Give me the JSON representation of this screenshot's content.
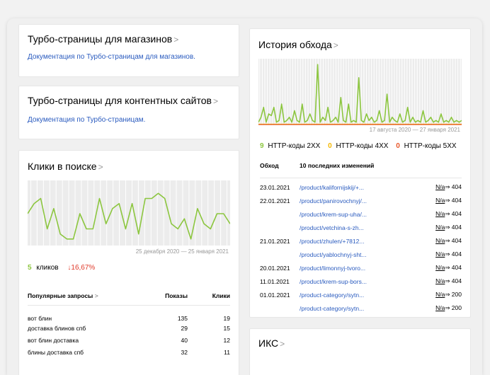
{
  "shops": {
    "title": "Турбо-страницы для магазинов",
    "link": "Документация по Турбо-страницам для магазинов."
  },
  "content_sites": {
    "title": "Турбо-страницы для контентных сайтов",
    "link": "Документация по Турбо-страницам."
  },
  "clicks": {
    "title": "Клики в поиске",
    "date_range": "25 декабря 2020 — 25 января 2021",
    "count": "5",
    "count_label": "кликов",
    "change": "↓16,67%",
    "table": {
      "headers": [
        "Популярные запросы",
        "Показы",
        "Клики"
      ],
      "rows": [
        [
          "вот блин",
          "135",
          "19"
        ],
        [
          "доставка блинов спб",
          "29",
          "15"
        ],
        [
          "вот блин доставка",
          "40",
          "12"
        ],
        [
          "блины доставка спб",
          "32",
          "11"
        ]
      ]
    }
  },
  "history": {
    "title": "История обхода",
    "date_range": "17 августа 2020 — 27 января 2021",
    "legend": [
      {
        "count": "9",
        "label": "HTTP-коды 2XX",
        "color": "#8cc63f"
      },
      {
        "count": "0",
        "label": "HTTP-коды 4XX",
        "color": "#f5b800"
      },
      {
        "count": "0",
        "label": "HTTP-коды 5XX",
        "color": "#e8572a"
      }
    ],
    "table": {
      "headers": [
        "Обход",
        "10 последних изменений"
      ],
      "rows": [
        [
          "23.01.2021",
          "/product/kalifornijskij/+...",
          "N/a",
          "⇒ 404"
        ],
        [
          "22.01.2021",
          "/product/panirovochnyj/...",
          "N/a",
          "⇒ 404"
        ],
        [
          "",
          "/product/krem-sup-uha/...",
          "N/a",
          "⇒ 404"
        ],
        [
          "",
          "/product/vetchina-s-zh...",
          "N/a",
          "⇒ 404"
        ],
        [
          "21.01.2021",
          "/product/zhulen/+7812...",
          "N/a",
          "⇒ 404"
        ],
        [
          "",
          "/product/yablochnyj-sht...",
          "N/a",
          "⇒ 404"
        ],
        [
          "20.01.2021",
          "/product/limonnyj-tvoro...",
          "N/a",
          "⇒ 404"
        ],
        [
          "11.01.2021",
          "/product/krem-sup-bors...",
          "N/a",
          "⇒ 404"
        ],
        [
          "01.01.2021",
          "/product-category/sytn...",
          "N/a",
          "⇒ 200"
        ],
        [
          "",
          "/product-category/sytn...",
          "N/a",
          "⇒ 200"
        ]
      ]
    }
  },
  "iks": {
    "title": "ИКС"
  },
  "chart_data": [
    {
      "type": "line",
      "title": "Клики в поиске",
      "series": [
        {
          "values": [
            3,
            4,
            4.5,
            1.5,
            3.5,
            1,
            0.5,
            0.5,
            3,
            1.5,
            1.5,
            4.5,
            2,
            3.5,
            4,
            1.5,
            4,
            1,
            4.5,
            4.5,
            5,
            4.5,
            2,
            1.5,
            2.5,
            0.5,
            3.5,
            2,
            1.5,
            3,
            3,
            2
          ]
        }
      ],
      "ylim": [
        0,
        6
      ],
      "grid": true
    },
    {
      "type": "line",
      "title": "История обхода",
      "series": [
        {
          "name": "HTTP-коды 2XX",
          "color": "#8cc63f",
          "values": [
            0.5,
            2,
            5,
            0.5,
            3,
            2.5,
            5,
            0.5,
            1,
            6,
            0.5,
            1,
            2,
            0.5,
            4,
            1,
            0.5,
            6,
            0.5,
            1,
            3,
            1,
            0.5,
            18,
            0.5,
            2,
            1,
            5,
            0.5,
            1,
            2,
            0.5,
            8,
            1,
            0.5,
            6,
            0.5,
            1,
            0.5,
            14,
            1,
            0.5,
            3,
            1,
            2,
            0.5,
            1,
            4,
            0.5,
            1,
            9,
            0.5,
            2,
            1,
            0.5,
            3,
            0.5,
            1,
            5,
            0.5,
            2,
            0.5,
            1,
            0.5,
            4,
            0.5,
            1,
            2,
            0.5,
            1,
            0.5,
            3,
            0.5,
            1,
            0.5,
            2,
            0.5,
            1,
            0.5,
            1
          ]
        },
        {
          "name": "HTTP-коды 4XX",
          "color": "#f5b800",
          "values": [
            0,
            0,
            0,
            0,
            0,
            0,
            0,
            0,
            0,
            0
          ]
        },
        {
          "name": "HTTP-коды 5XX",
          "color": "#e8572a",
          "values": [
            0,
            0,
            0,
            0,
            0,
            0,
            0,
            0,
            0,
            0
          ]
        }
      ],
      "grid": true
    }
  ]
}
